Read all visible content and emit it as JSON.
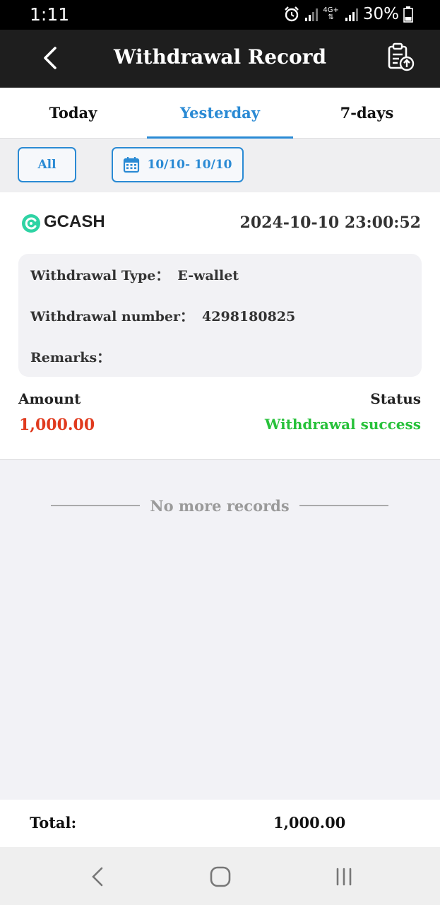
{
  "status_bar": {
    "time": "1:11",
    "network": "4G+",
    "battery": "30%"
  },
  "header": {
    "title": "Withdrawal Record"
  },
  "tabs": [
    {
      "label": "Today",
      "active": false
    },
    {
      "label": "Yesterday",
      "active": true
    },
    {
      "label": "7-days",
      "active": false
    }
  ],
  "filters": {
    "all_label": "All",
    "date_range": "10/10- 10/10"
  },
  "record": {
    "method": "GCASH",
    "datetime": "2024-10-10 23:00:52",
    "type_label": "Withdrawal Type：",
    "type_value": "E-wallet",
    "number_label": "Withdrawal number：",
    "number_value": "4298180825",
    "remarks_label": "Remarks：",
    "remarks_value": "",
    "amount_label": "Amount",
    "amount_value": "1,000.00",
    "status_label": "Status",
    "status_value": "Withdrawal success"
  },
  "list_end_text": "No more records",
  "total": {
    "label": "Total:",
    "value": "1,000.00"
  },
  "colors": {
    "accent": "#2a8ad4",
    "amount": "#e03a1e",
    "success": "#27c13a",
    "header_bg": "#1e1e1e"
  }
}
